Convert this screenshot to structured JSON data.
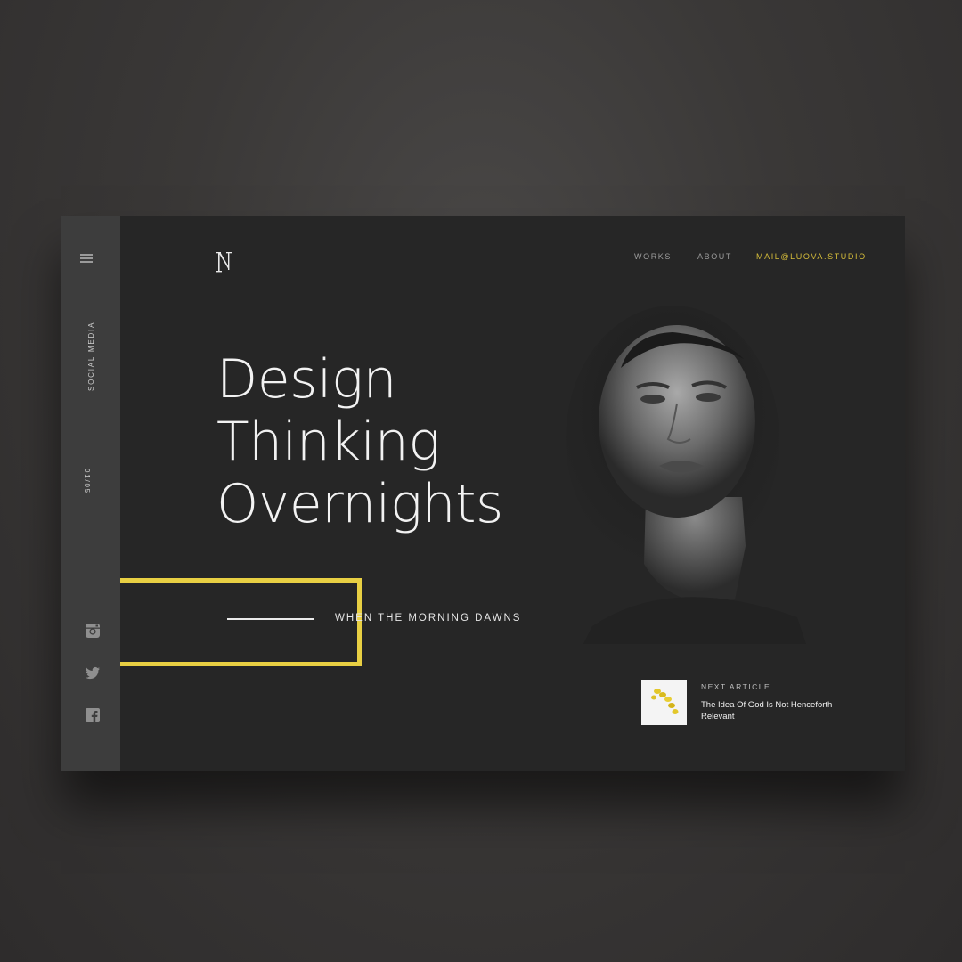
{
  "sidebar": {
    "menu_icon": "hamburger-menu-icon",
    "social_label": "SOCIAL MEDIA",
    "slide_counter": "01/05",
    "social_icons": [
      "instagram-icon",
      "twitter-icon",
      "facebook-icon"
    ]
  },
  "header": {
    "logo_letter": "N",
    "nav": {
      "works": "WORKS",
      "about": "ABOUT",
      "mail": "MAIL@LUOVA.STUDIO"
    }
  },
  "hero": {
    "headline_lines": [
      "Design",
      "Thinking",
      "Overnights"
    ],
    "tagline": "WHEN THE MORNING DAWNS"
  },
  "next_article": {
    "label": "NEXT ARTICLE",
    "title": "The Idea Of God Is Not Henceforth Relevant"
  },
  "colors": {
    "accent_yellow": "#e8cf43",
    "panel_dark": "#262626",
    "sidebar": "#3d3d3d",
    "background": "#3a3837"
  }
}
